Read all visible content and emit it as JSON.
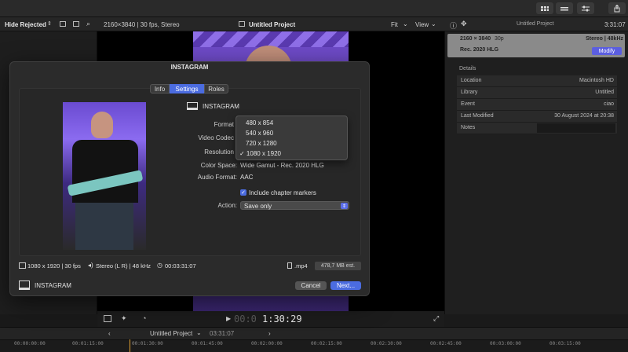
{
  "colors": {
    "accent": "#4b6ce0",
    "modify": "#5b5ee0",
    "background": "#1a1a1a"
  },
  "browser": {
    "filter_label": "Hide Rejected"
  },
  "viewer": {
    "format_info": "2160×3840 | 30 fps, Stereo",
    "project_name": "Untitled Project",
    "fit_label": "Fit",
    "view_label": "View",
    "timecode_prefix": "00:0",
    "timecode_main": "1:30:29"
  },
  "inspector": {
    "title": "Untitled Project",
    "duration": "3:31:07",
    "header_res": "2160 × 3840",
    "header_fps": "30p",
    "header_audio": "Stereo | 48kHz",
    "header_color": "Rec. 2020 HLG",
    "modify_label": "Modify",
    "details_label": "Details",
    "rows": [
      {
        "key": "Location",
        "value": "Macintosh HD"
      },
      {
        "key": "Library",
        "value": "Untitled"
      },
      {
        "key": "Event",
        "value": "ciao"
      },
      {
        "key": "Last Modified",
        "value": "30 August 2024 at 20:38"
      },
      {
        "key": "Notes",
        "value": ""
      }
    ]
  },
  "dialog": {
    "title": "INSTAGRAM",
    "tabs": [
      "Info",
      "Settings",
      "Roles"
    ],
    "destination_name": "INSTAGRAM",
    "labels": {
      "format": "Format",
      "video_codec": "Video Codec",
      "resolution": "Resolution",
      "color_space": "Color Space:",
      "audio_format": "Audio Format:",
      "action": "Action:"
    },
    "color_space_value": "Wide Gamut - Rec. 2020 HLG",
    "audio_format_value": "AAC",
    "include_chapter_markers": "Include chapter markers",
    "action_value": "Save only",
    "resolution_options": [
      "480 x 854",
      "540 x 960",
      "720 x 1280",
      "1080 x 1920"
    ],
    "resolution_selected": "✓ 1080 x 1920",
    "info_resolution": "1080 x 1920 | 30 fps",
    "info_audio": "Stereo (L R) | 48 kHz",
    "info_duration": "00:03:31:07",
    "info_ext": ".mp4",
    "info_size": "478,7 MB est.",
    "footer_name": "INSTAGRAM",
    "cancel_label": "Cancel",
    "next_label": "Next..."
  },
  "timeline": {
    "project_name": "Untitled Project",
    "duration": "03:31:07",
    "ticks": [
      "00:00:00:00",
      "00:01:15:00",
      "00:01:30:00",
      "00:01:45:00",
      "00:02:00:00",
      "00:02:15:00",
      "00:02:30:00",
      "00:02:45:00",
      "00:03:00:00",
      "00:03:15:00",
      "00:03:30:00"
    ]
  }
}
